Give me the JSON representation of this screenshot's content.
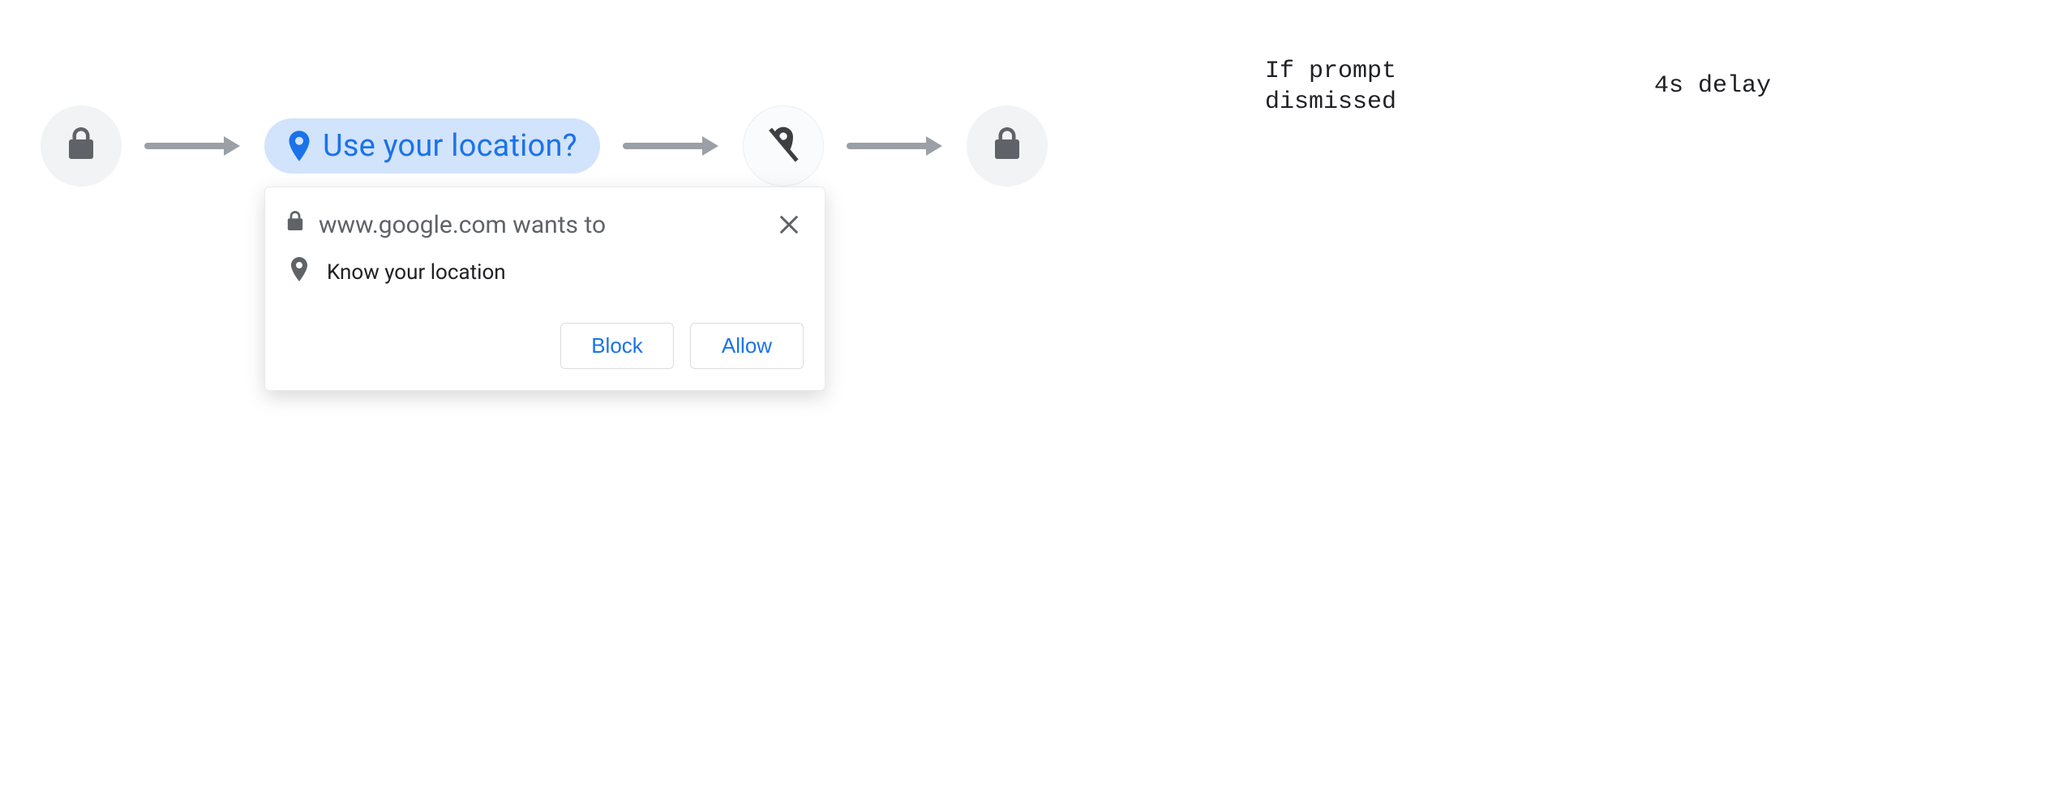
{
  "flow": {
    "chip_label": "Use your location?",
    "caption_dismissed": "If prompt\ndismissed",
    "caption_delay": "4s delay"
  },
  "popup": {
    "site": "www.google.com wants to",
    "permission_label": "Know your location",
    "block_label": "Block",
    "allow_label": "Allow"
  }
}
